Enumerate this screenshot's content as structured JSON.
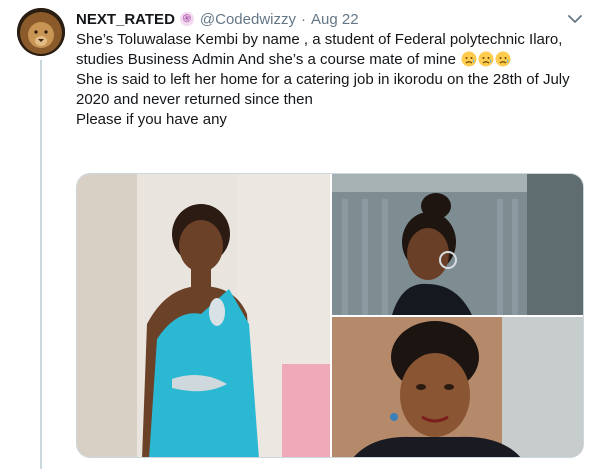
{
  "tweet": {
    "display_name": "NEXT_RATED",
    "badge_icon": "spiral-icon",
    "handle": "@Codedwizzy",
    "separator": "·",
    "date": "Aug 22",
    "paragraph_1": "She’s Toluwalase Kembi by name , a student of Federal polytechnic Ilaro, studies Business Admin And she’s a course mate of mine",
    "paragraph_2": "She is said to left her home for a catering job in ikorodu on the 28th of July 2020 and never returned since then",
    "paragraph_3": "Please if you have any",
    "emoji_count_icon": "sad-but-relieved-face-icon"
  },
  "media": {
    "photos": [
      "photo-1",
      "photo-2",
      "photo-3"
    ]
  },
  "colors": {
    "text": "#14171a",
    "secondary": "#657786",
    "thread_line": "#ccd6dd"
  }
}
